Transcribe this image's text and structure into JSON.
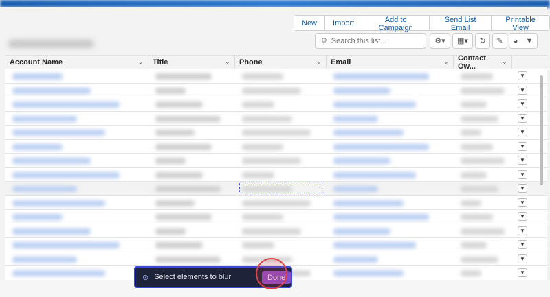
{
  "actions": [
    "New",
    "Import",
    "Add to Campaign",
    "Send List Email",
    "Printable View"
  ],
  "search": {
    "placeholder": "Search this list..."
  },
  "toolbar_icons": [
    "gear-icon",
    "table-view-icon",
    "refresh-icon",
    "edit-icon",
    "chart-icon",
    "filter-icon"
  ],
  "columns": [
    "Account Name",
    "Title",
    "Phone",
    "Email",
    "Contact Ow..."
  ],
  "toast": {
    "label": "Select elements to blur",
    "done_label": "Done"
  },
  "colors": {
    "link": "#0b5cab",
    "toast_bg": "#1d2338",
    "toast_border": "#3b4bd8",
    "done": "#8a4bc6",
    "highlight_ring": "#e0404a"
  }
}
